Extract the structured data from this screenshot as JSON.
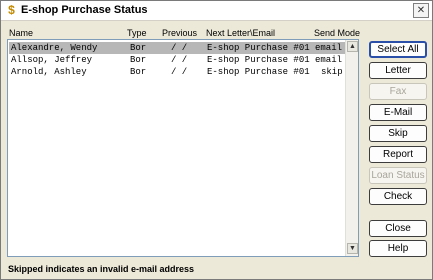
{
  "window": {
    "title": "E-shop Purchase Status",
    "close_glyph": "✕",
    "icon_glyph": "$"
  },
  "columns": [
    "Name",
    "Type",
    "Previous",
    "Next Letter\\Email",
    "Send Mode"
  ],
  "rows": [
    {
      "name": "Alexandre, Wendy",
      "type": "Bor",
      "previous": "/  /",
      "next": "E-shop Purchase #01",
      "mode": "email",
      "selected": true
    },
    {
      "name": "Allsop, Jeffrey",
      "type": "Bor",
      "previous": "/  /",
      "next": "E-shop Purchase #01",
      "mode": "email",
      "selected": false
    },
    {
      "name": "Arnold, Ashley",
      "type": "Bor",
      "previous": "/  /",
      "next": "E-shop Purchase #01",
      "mode": "skip",
      "selected": false
    }
  ],
  "buttons": {
    "select_all": "Select All",
    "letter": "Letter",
    "fax": "Fax",
    "email": "E-Mail",
    "skip": "Skip",
    "report": "Report",
    "loan_status": "Loan Status",
    "check": "Check",
    "close": "Close",
    "help": "Help"
  },
  "scroll": {
    "up": "▲",
    "down": "▼"
  },
  "status_text": "Skipped indicates an invalid e-mail address"
}
